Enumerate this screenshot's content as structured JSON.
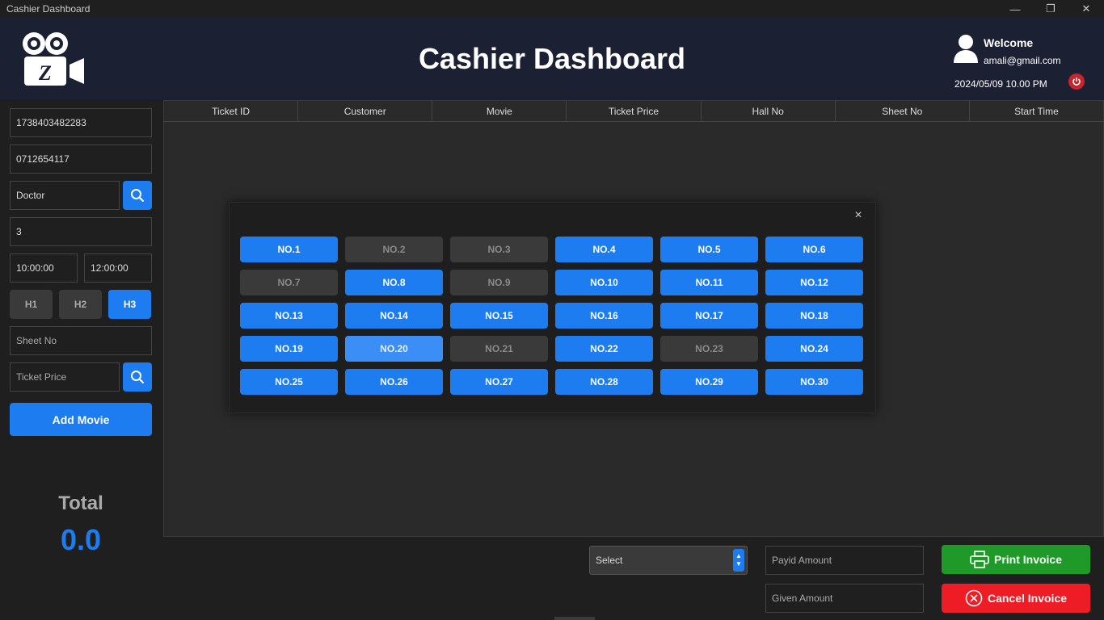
{
  "window": {
    "title": "Cashier Dashboard",
    "minimize": "—",
    "restore": "❐",
    "close": "✕"
  },
  "header": {
    "title": "Cashier Dashboard",
    "welcome": "Welcome",
    "email": "amali@gmail.com",
    "datetime": "2024/05/09   10.00 PM"
  },
  "form": {
    "ticket_id": "1738403482283",
    "phone": "0712654117",
    "movie": "Doctor",
    "quantity": "3",
    "start_time": "10:00:00",
    "end_time": "12:00:00",
    "halls": [
      "H1",
      "H2",
      "H3"
    ],
    "active_hall": "H3",
    "sheet_no_placeholder": "Sheet No",
    "ticket_price_placeholder": "Ticket Price",
    "add_movie": "Add Movie"
  },
  "total": {
    "label": "Total",
    "value": "0.0"
  },
  "table": {
    "columns": [
      "Ticket ID",
      "Customer",
      "Movie",
      "Ticket Price",
      "Hall No",
      "Sheet No",
      "Start Time"
    ],
    "rows": []
  },
  "seat_dialog": {
    "close_icon": "×",
    "seats": [
      {
        "label": "NO.1",
        "status": "available"
      },
      {
        "label": "NO.2",
        "status": "booked"
      },
      {
        "label": "NO.3",
        "status": "booked"
      },
      {
        "label": "NO.4",
        "status": "available"
      },
      {
        "label": "NO.5",
        "status": "available"
      },
      {
        "label": "NO.6",
        "status": "available"
      },
      {
        "label": "NO.7",
        "status": "booked"
      },
      {
        "label": "NO.8",
        "status": "available"
      },
      {
        "label": "NO.9",
        "status": "booked"
      },
      {
        "label": "NO.10",
        "status": "available"
      },
      {
        "label": "NO.11",
        "status": "available"
      },
      {
        "label": "NO.12",
        "status": "available"
      },
      {
        "label": "NO.13",
        "status": "available"
      },
      {
        "label": "NO.14",
        "status": "available"
      },
      {
        "label": "NO.15",
        "status": "available"
      },
      {
        "label": "NO.16",
        "status": "available"
      },
      {
        "label": "NO.17",
        "status": "available"
      },
      {
        "label": "NO.18",
        "status": "available"
      },
      {
        "label": "NO.19",
        "status": "available"
      },
      {
        "label": "NO.20",
        "status": "selected"
      },
      {
        "label": "NO.21",
        "status": "booked"
      },
      {
        "label": "NO.22",
        "status": "available"
      },
      {
        "label": "NO.23",
        "status": "booked"
      },
      {
        "label": "NO.24",
        "status": "available"
      },
      {
        "label": "NO.25",
        "status": "available"
      },
      {
        "label": "NO.26",
        "status": "available"
      },
      {
        "label": "NO.27",
        "status": "available"
      },
      {
        "label": "NO.28",
        "status": "available"
      },
      {
        "label": "NO.29",
        "status": "available"
      },
      {
        "label": "NO.30",
        "status": "available"
      }
    ]
  },
  "footer": {
    "select_value": "Select",
    "payid_placeholder": "Payid Amount",
    "given_placeholder": "Given Amount",
    "print_invoice": "Print Invoice",
    "cancel_invoice": "Cancel Invoice"
  },
  "colors": {
    "accent": "#1c7cf0",
    "header_bg": "#1c2033",
    "print": "#1f9a28",
    "cancel": "#ee1c24",
    "booked": "#3a3a3a"
  }
}
